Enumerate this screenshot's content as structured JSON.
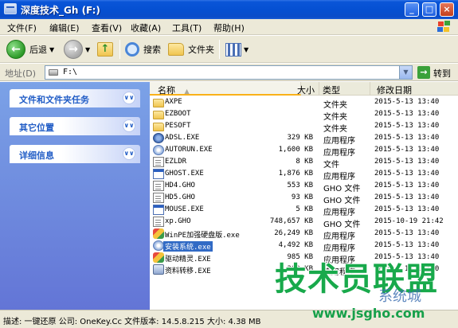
{
  "window": {
    "title": "深度技术_Gh (F:)",
    "minimize": "_",
    "maximize": "□",
    "close": "×"
  },
  "menu": [
    "文件(F)",
    "编辑(E)",
    "查看(V)",
    "收藏(A)",
    "工具(T)",
    "帮助(H)"
  ],
  "toolbar": {
    "back": "后退",
    "search": "搜索",
    "folders": "文件夹"
  },
  "address": {
    "label": "地址(D)",
    "value": "F:\\",
    "go": "转到"
  },
  "left_panel": [
    "文件和文件夹任务",
    "其它位置",
    "详细信息"
  ],
  "columns": {
    "name": "名称",
    "size": "大小",
    "type": "类型",
    "modified": "修改日期"
  },
  "files": [
    {
      "icon": "folder-icon",
      "name": "AXPE",
      "size": "",
      "type": "文件夹",
      "modified": "2015-5-13 13:40"
    },
    {
      "icon": "folder-icon",
      "name": "EZBOOT",
      "size": "",
      "type": "文件夹",
      "modified": "2015-5-13 13:40"
    },
    {
      "icon": "folder-icon",
      "name": "PESOFT",
      "size": "",
      "type": "文件夹",
      "modified": "2015-5-13 13:40"
    },
    {
      "icon": "gear-icon",
      "name": "ADSL.EXE",
      "size": "329 KB",
      "type": "应用程序",
      "modified": "2015-5-13 13:40"
    },
    {
      "icon": "cdrom-icon",
      "name": "AUTORUN.EXE",
      "size": "1,600 KB",
      "type": "应用程序",
      "modified": "2015-5-13 13:40"
    },
    {
      "icon": "file-icon",
      "name": "EZLDR",
      "size": "8 KB",
      "type": "文件",
      "modified": "2015-5-13 13:40"
    },
    {
      "icon": "exe-icon",
      "name": "GHOST.EXE",
      "size": "1,876 KB",
      "type": "应用程序",
      "modified": "2015-5-13 13:40"
    },
    {
      "icon": "file-icon",
      "name": "HD4.GHO",
      "size": "553 KB",
      "type": "GHO 文件",
      "modified": "2015-5-13 13:40"
    },
    {
      "icon": "file-icon",
      "name": "HD5.GHO",
      "size": "93 KB",
      "type": "GHO 文件",
      "modified": "2015-5-13 13:40"
    },
    {
      "icon": "exe-icon",
      "name": "MOUSE.EXE",
      "size": "5 KB",
      "type": "应用程序",
      "modified": "2015-5-13 13:40"
    },
    {
      "icon": "file-icon",
      "name": "xp.GHO",
      "size": "748,657 KB",
      "type": "GHO 文件",
      "modified": "2015-10-19 21:42"
    },
    {
      "icon": "tool-icon",
      "name": "WinPE加强硬盘版.exe",
      "size": "26,249 KB",
      "type": "应用程序",
      "modified": "2015-5-13 13:40"
    },
    {
      "icon": "cdrom-icon",
      "name": "安装系统.exe",
      "size": "4,492 KB",
      "type": "应用程序",
      "modified": "2015-5-13 13:40",
      "selected": true
    },
    {
      "icon": "tool-icon",
      "name": "驱动精灵.EXE",
      "size": "985 KB",
      "type": "应用程序",
      "modified": "2015-5-13 13:40"
    },
    {
      "icon": "pc-icon",
      "name": "资料转移.EXE",
      "size": "389 KB",
      "type": "应用程序",
      "modified": "2015-5-13 13:40"
    }
  ],
  "status": "描述: 一键还原 公司: OneKey.Cc 文件版本: 14.5.8.215 大小: 4.38 MB",
  "watermark": {
    "big": "技术员联盟",
    "url": "www.jsgho.com",
    "side": "系统城"
  }
}
